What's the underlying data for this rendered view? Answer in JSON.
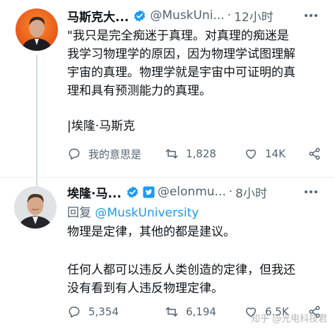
{
  "tweet1": {
    "display_name": "马斯克大...",
    "handle": "@MuskUni...",
    "separator": "·",
    "time": "12小时",
    "lines": [
      "\"我只是完全痴迷于真理。对真理的痴迷是",
      "我学习物理学的原因，因为物理学试图理解",
      "宇宙的真理。物理学就是宇宙中可证明的真",
      "理和具有预测能力的真理。"
    ],
    "signature": "|埃隆·马斯克",
    "reply_label": "我的意思是",
    "retweet_count": "1,828",
    "like_count": "14K"
  },
  "tweet2": {
    "display_name": "埃隆·马...",
    "handle": "@elonmu...",
    "separator": "·",
    "time": "8小时",
    "reply_prefix": "回复",
    "reply_mention": "@MuskUniversity",
    "line1": "物理是定律，其他的都是建议。",
    "lines2": [
      "任何人都可以违反人类创造的定律，但我还",
      "没有看到有人违反物理定律。"
    ],
    "reply_count": "5,354",
    "retweet_count": "6,194",
    "like_count": "6.5K"
  },
  "watermark": "知乎 @光电科技君",
  "colors": {
    "text": "#0f1419",
    "muted": "#536471",
    "link": "#1d9bf0",
    "verified": "#1d9bf0",
    "divider": "#eff3f4"
  },
  "icons": [
    "verified-badge-icon",
    "twitter-bird-badge-icon",
    "more-icon",
    "reply-icon",
    "retweet-icon",
    "like-icon",
    "share-icon"
  ]
}
